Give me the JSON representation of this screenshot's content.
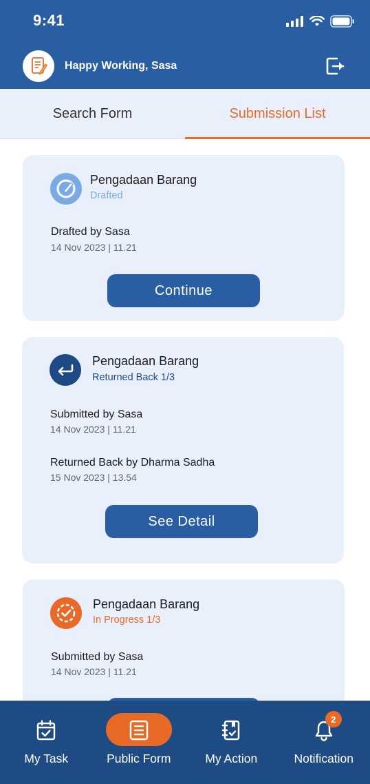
{
  "status_bar": {
    "time": "9:41"
  },
  "header": {
    "greeting": "Happy Working, Sasa"
  },
  "tabs": [
    {
      "label": "Search Form",
      "active": false
    },
    {
      "label": "Submission List",
      "active": true
    }
  ],
  "cards": [
    {
      "title": "Pengadaan Barang",
      "status": "Drafted",
      "status_color": "#7aaae6",
      "lines": [
        {
          "label": "Drafted by Sasa",
          "date": "14 Nov 2023 | 11.21"
        }
      ],
      "button_label": "Continue",
      "icon": "edit-icon"
    },
    {
      "title": "Pengadaan Barang",
      "status": "Returned Back 1/3",
      "status_color": "#1f4b85",
      "lines": [
        {
          "label": "Submitted by Sasa",
          "date": "14 Nov 2023 | 11.21"
        },
        {
          "label": "Returned Back by Dharma Sadha",
          "date": "15 Nov 2023 | 13.54"
        }
      ],
      "button_label": "See Detail",
      "icon": "return-arrow-icon"
    },
    {
      "title": "Pengadaan Barang",
      "status": "In Progress 1/3",
      "status_color": "#e86a26",
      "lines": [
        {
          "label": "Submitted by Sasa",
          "date": "14 Nov 2023 | 11.21"
        }
      ],
      "icon": "in-progress-check-icon"
    }
  ],
  "bottom_nav": [
    {
      "label": "My Task",
      "icon": "calendar-check-icon",
      "active": false
    },
    {
      "label": "Public Form",
      "icon": "form-list-icon",
      "active": true
    },
    {
      "label": "My Action",
      "icon": "notebook-check-icon",
      "active": false
    },
    {
      "label": "Notification",
      "icon": "bell-icon",
      "active": false,
      "badge": "2"
    }
  ],
  "colors": {
    "primary": "#2a5ea3",
    "accent": "#e86a26",
    "card_bg": "#e9effb"
  }
}
